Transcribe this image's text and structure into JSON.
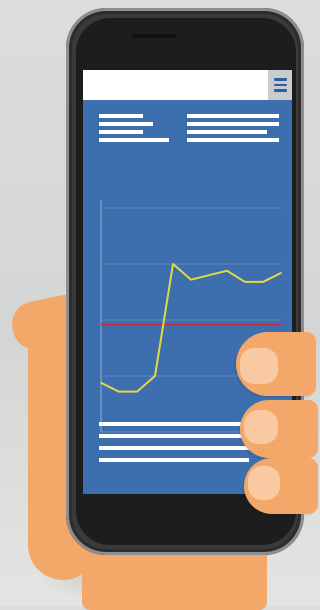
{
  "colors": {
    "screen_background": "#3d6ead",
    "reference_line": "#c8323c",
    "trend_line": "#e2d846",
    "skin": "#f3a86a"
  },
  "icons": {
    "menu": "hamburger-menu-icon"
  },
  "chart_data": {
    "type": "line",
    "title": "",
    "xlabel": "",
    "ylabel": "",
    "grid": true,
    "ylim": [
      0,
      100
    ],
    "x": [
      0,
      1,
      2,
      3,
      4,
      5,
      6,
      7,
      8,
      9,
      10
    ],
    "series": [
      {
        "values": [
          22,
          18,
          18,
          25,
          75,
          68,
          70,
          72,
          67,
          67,
          71
        ]
      }
    ],
    "reference_line": {
      "value": 48
    }
  }
}
